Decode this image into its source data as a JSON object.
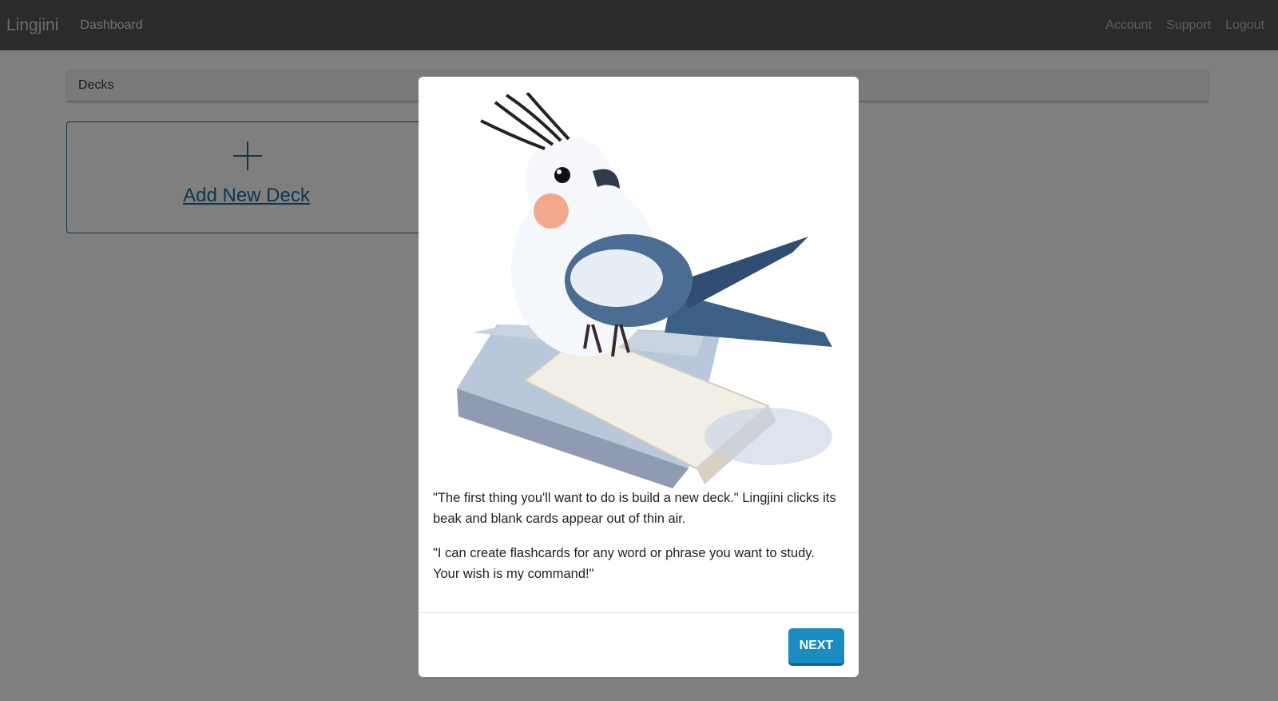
{
  "navbar": {
    "brand": "Lingjini",
    "dashboard_label": "Dashboard",
    "right_links": [
      "Account",
      "Support",
      "Logout"
    ]
  },
  "decks": {
    "header": "Decks",
    "add_new_label": "Add New Deck"
  },
  "modal": {
    "illustration": "cockatiel-on-card-deck",
    "paragraphs": [
      "\"The first thing you'll want to do is build a new deck.\" Lingjini clicks its beak and blank cards appear out of thin air.",
      "\"I can create flashcards for any word or phrase you want to study. Your wish is my command!\""
    ],
    "next_label": "NEXT"
  },
  "colors": {
    "accent": "#1f6d9c",
    "button": "#1b8bc4",
    "navbar": "#575757"
  }
}
